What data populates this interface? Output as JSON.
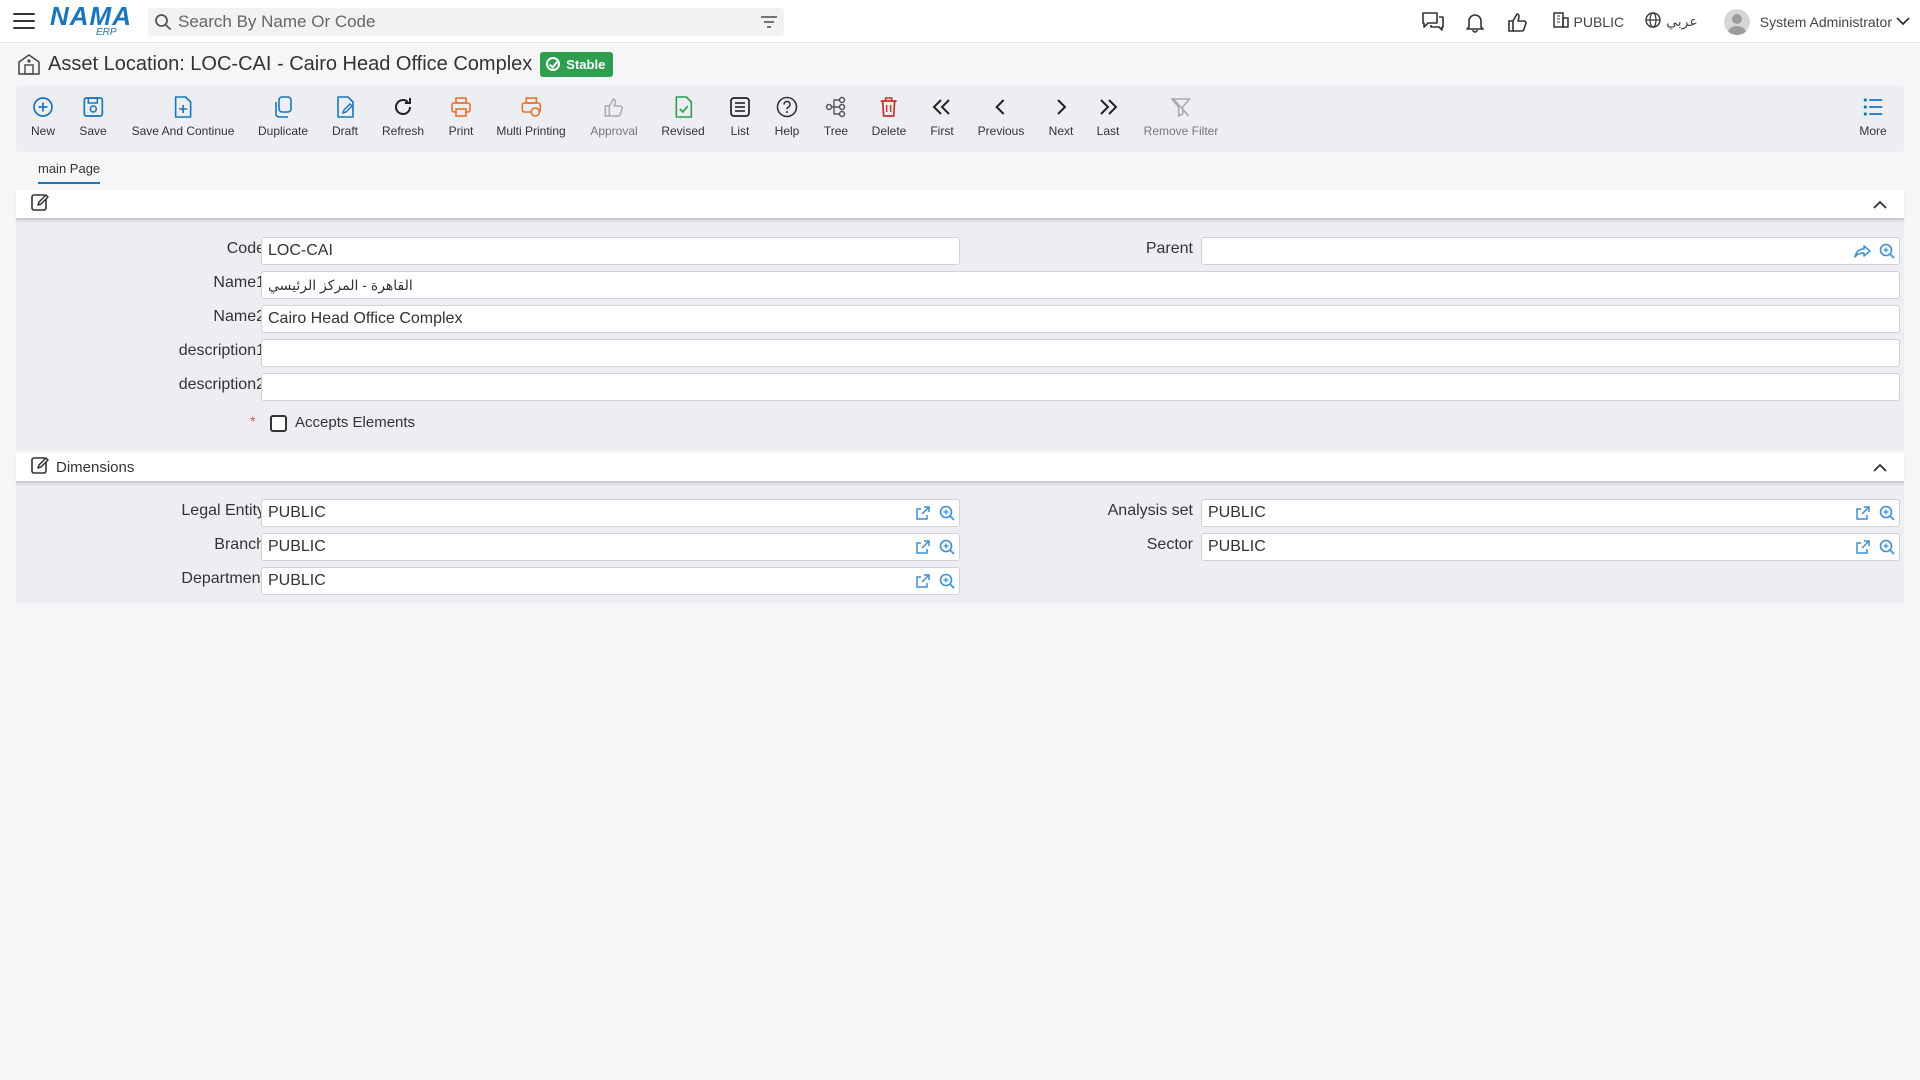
{
  "topbar": {
    "logo_main": "NAMA",
    "logo_sub": "ERP",
    "search_placeholder": "Search By Name Or Code",
    "legal_entity": "PUBLIC",
    "language": "عربي",
    "user_name": "System Administrator"
  },
  "page": {
    "title": "Asset Location: LOC-CAI - Cairo Head Office Complex",
    "status": "Stable",
    "status_color": "#2e9e4f"
  },
  "toolbar": [
    {
      "label": "New",
      "icon": "plus-circle-icon",
      "color": "#1b75bc"
    },
    {
      "label": "Save",
      "icon": "save-icon",
      "color": "#1b75bc"
    },
    {
      "label": "Save And Continue",
      "icon": "file-plus-icon",
      "color": "#1b75bc"
    },
    {
      "label": "Duplicate",
      "icon": "copy-icon",
      "color": "#1b75bc"
    },
    {
      "label": "Draft",
      "icon": "draft-edit-icon",
      "color": "#1b75bc"
    },
    {
      "label": "Refresh",
      "icon": "refresh-icon",
      "color": "#222"
    },
    {
      "label": "Print",
      "icon": "printer-icon",
      "color": "#e5712a"
    },
    {
      "label": "Multi Printing",
      "icon": "multi-printer-icon",
      "color": "#e5712a"
    },
    {
      "label": "Approval",
      "icon": "thumbs-up-icon",
      "color": "#aaaaaa"
    },
    {
      "label": "Revised",
      "icon": "file-check-icon",
      "color": "#2e9e4f"
    },
    {
      "label": "List",
      "icon": "list-icon",
      "color": "#222"
    },
    {
      "label": "Help",
      "icon": "help-circle-icon",
      "color": "#333"
    },
    {
      "label": "Tree",
      "icon": "tree-icon",
      "color": "#555"
    },
    {
      "label": "Delete",
      "icon": "trash-icon",
      "color": "#c9302c"
    },
    {
      "label": "First",
      "icon": "chevrons-left-icon",
      "color": "#222"
    },
    {
      "label": "Previous",
      "icon": "chevron-left-icon",
      "color": "#222"
    },
    {
      "label": "Next",
      "icon": "chevron-right-icon",
      "color": "#222"
    },
    {
      "label": "Last",
      "icon": "chevrons-right-icon",
      "color": "#222"
    },
    {
      "label": "Remove Filter",
      "icon": "filter-off-icon",
      "color": "#aaaaaa"
    },
    {
      "label": "More",
      "icon": "more-list-icon",
      "color": "#1b75bc"
    }
  ],
  "tabs": [
    {
      "label": "main Page",
      "active": true
    }
  ],
  "main_section": {
    "fields": {
      "code": {
        "label": "Code",
        "value": "LOC-CAI"
      },
      "parent": {
        "label": "Parent",
        "value": ""
      },
      "name1": {
        "label": "Name1",
        "value": "القاهرة - المركز الرئيسي"
      },
      "name2": {
        "label": "Name2",
        "value": "Cairo Head Office Complex"
      },
      "description1": {
        "label": "description1",
        "value": ""
      },
      "description2": {
        "label": "description2",
        "value": ""
      },
      "accepts_elements": {
        "label": "Accepts Elements",
        "checked": false,
        "required_mark": "*"
      }
    }
  },
  "dimensions_section": {
    "title": "Dimensions",
    "fields": {
      "legal_entity": {
        "label": "Legal Entity",
        "value": "PUBLIC"
      },
      "analysis_set": {
        "label": "Analysis set",
        "value": "PUBLIC"
      },
      "branch": {
        "label": "Branch",
        "value": "PUBLIC"
      },
      "sector": {
        "label": "Sector",
        "value": "PUBLIC"
      },
      "department": {
        "label": "Department",
        "value": "PUBLIC"
      }
    }
  }
}
